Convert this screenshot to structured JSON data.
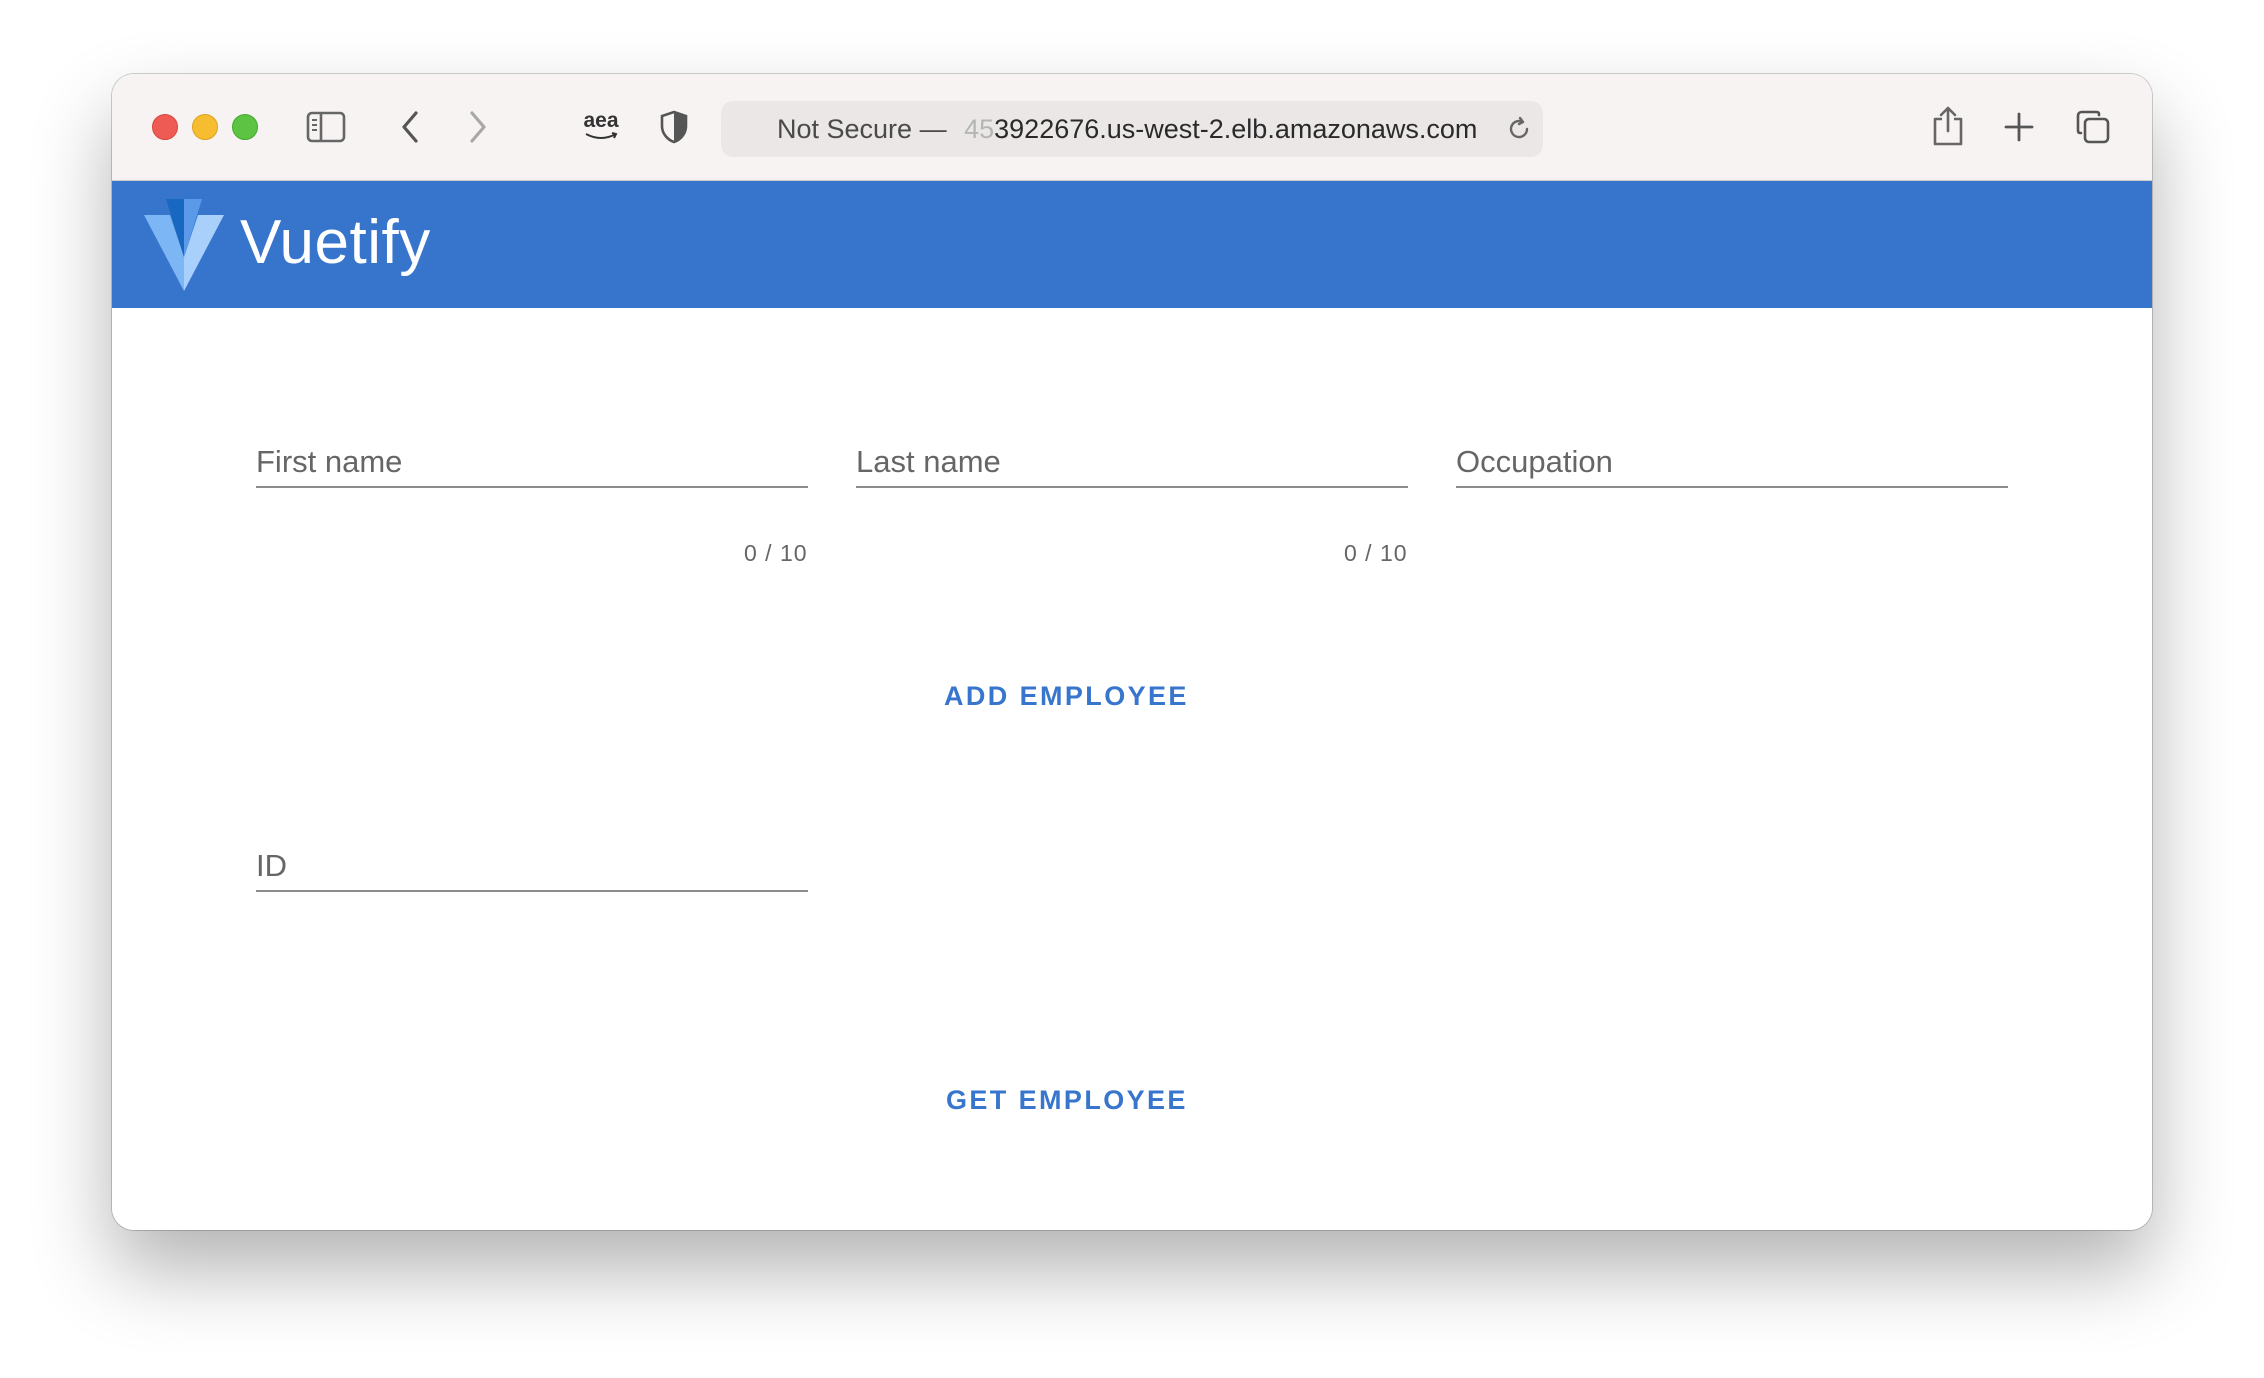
{
  "browser": {
    "address": {
      "security_label": "Not Secure —",
      "host_prefix": "45",
      "host_rest": "3922676.us-west-2.elb.amazonaws.com"
    },
    "icons": {
      "sidebar": "sidebar-icon",
      "back": "chevron-left-icon",
      "forward": "chevron-right-icon",
      "extension": "aea-extension-icon",
      "privacy": "shield-icon",
      "reload": "reload-icon",
      "share": "share-icon",
      "new_tab": "plus-icon",
      "tabs": "tab-overview-icon"
    },
    "extension_label": "aea"
  },
  "app": {
    "title": "Vuetify",
    "brand_color": "#3775cd",
    "accent_color": "#3776cc"
  },
  "form": {
    "first_name": {
      "label": "First name",
      "value": "",
      "counter": "0 / 10"
    },
    "last_name": {
      "label": "Last name",
      "value": "",
      "counter": "0 / 10"
    },
    "occupation": {
      "label": "Occupation",
      "value": ""
    },
    "add_button": "ADD EMPLOYEE",
    "id_field": {
      "label": "ID",
      "value": ""
    },
    "get_button": "GET EMPLOYEE"
  }
}
